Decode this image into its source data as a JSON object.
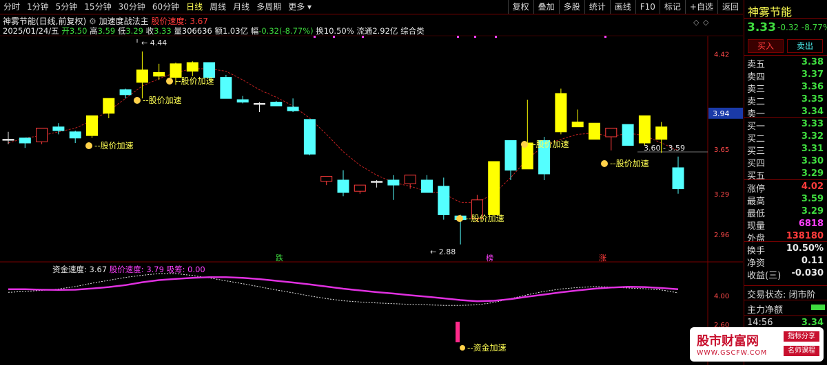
{
  "toolbar": {
    "periods": [
      "分时",
      "1分钟",
      "5分钟",
      "15分钟",
      "30分钟",
      "60分钟",
      "日线",
      "周线",
      "月线",
      "多周期",
      "更多"
    ],
    "active": "日线",
    "right": [
      "复权",
      "叠加",
      "多股",
      "统计",
      "画线",
      "F10",
      "标记",
      "+自选",
      "返回"
    ]
  },
  "info": {
    "title": "神雾节能(日线,前复权)",
    "indicator": "加速度战法主",
    "speed_label": "股价速度:",
    "speed_value": "3.67",
    "date": "2025/01/24/五",
    "open_label": "开",
    "open": "3.50",
    "high_label": "高",
    "high": "3.59",
    "low_label": "低",
    "low": "3.29",
    "close_label": "收",
    "close": "3.33",
    "vol_label": "量",
    "vol": "306636",
    "amt_label": "额",
    "amt": "1.03亿",
    "chg_label": "幅",
    "chg": "-0.32(-8.77%)",
    "turn_label": "换",
    "turn": "10.50%",
    "float_label": "流通",
    "float": "2.92亿",
    "category": "综合类"
  },
  "sub_info": {
    "fund_label": "资金速度:",
    "fund_value": "3.67",
    "stock_label": "股价速度:",
    "stock_value": "3.79",
    "absorb_label": "吸筹:",
    "absorb_value": "0.00"
  },
  "annotations": {
    "accel": "股价加速",
    "fund_accel": "资金加速",
    "high_mark": "4.44",
    "low_mark": "2.88",
    "range_mark": "3.60 - 3.59",
    "tag_fall": "跌",
    "tag_list": "榜",
    "tag_rise": "涨"
  },
  "axis": {
    "main": [
      "4.42",
      "3.94",
      "3.65",
      "3.29",
      "2.96"
    ],
    "sub": [
      "4.00",
      "2.60"
    ],
    "current_price": "3.94"
  },
  "panel": {
    "name": "神雾节能",
    "price": "3.33",
    "change": "-0.32",
    "pct": "-8.77%",
    "buy_btn": "买入",
    "sell_btn": "卖出",
    "asks": [
      {
        "label": "卖五",
        "price": "3.38"
      },
      {
        "label": "卖四",
        "price": "3.37"
      },
      {
        "label": "卖三",
        "price": "3.36"
      },
      {
        "label": "卖二",
        "price": "3.35"
      },
      {
        "label": "卖一",
        "price": "3.34"
      }
    ],
    "bids": [
      {
        "label": "买一",
        "price": "3.33"
      },
      {
        "label": "买二",
        "price": "3.32"
      },
      {
        "label": "买三",
        "price": "3.31"
      },
      {
        "label": "买四",
        "price": "3.30"
      },
      {
        "label": "买五",
        "price": "3.29"
      }
    ],
    "stats": [
      {
        "label": "涨停",
        "value": "4.02",
        "color": "#ff3b3b"
      },
      {
        "label": "最高",
        "value": "3.59",
        "color": "#3fdc3f"
      },
      {
        "label": "最低",
        "value": "3.29",
        "color": "#3fdc3f"
      },
      {
        "label": "现量",
        "value": "6818",
        "color": "#ff40ff"
      },
      {
        "label": "外盘",
        "value": "138180",
        "color": "#ff3b3b"
      }
    ],
    "stats2": [
      {
        "label": "换手",
        "value": "10.50%",
        "color": "#e8e8e8"
      },
      {
        "label": "净资",
        "value": "0.11",
        "color": "#e8e8e8"
      },
      {
        "label": "收益(三)",
        "value": "-0.030",
        "color": "#e8e8e8"
      }
    ],
    "trade_state": "交易状态: 闭市阶",
    "main_net": "主力净额",
    "time": "14:56",
    "time_price": "3.34"
  },
  "watermark": {
    "name": "股市财富网",
    "url": "WWW.GSCFW.COM",
    "tag1": "指标分享",
    "tag2": "名师课程"
  },
  "chart_data": {
    "type": "candlestick",
    "ylim": [
      2.8,
      4.55
    ],
    "candles": [
      {
        "o": 3.73,
        "h": 3.79,
        "l": 3.69,
        "c": 3.73
      },
      {
        "o": 3.7,
        "h": 3.74,
        "l": 3.66,
        "c": 3.74
      },
      {
        "o": 3.71,
        "h": 3.82,
        "l": 3.69,
        "c": 3.82
      },
      {
        "o": 3.8,
        "h": 3.86,
        "l": 3.77,
        "c": 3.83
      },
      {
        "o": 3.74,
        "h": 3.8,
        "l": 3.7,
        "c": 3.79
      },
      {
        "o": 3.76,
        "h": 3.92,
        "l": 3.74,
        "c": 3.92
      },
      {
        "o": 3.94,
        "h": 4.06,
        "l": 3.9,
        "c": 4.06
      },
      {
        "o": 4.09,
        "h": 4.14,
        "l": 4.06,
        "c": 4.13
      },
      {
        "o": 4.19,
        "h": 4.44,
        "l": 4.06,
        "c": 4.29
      },
      {
        "o": 4.27,
        "h": 4.34,
        "l": 4.21,
        "c": 4.24
      },
      {
        "o": 4.23,
        "h": 4.35,
        "l": 4.17,
        "c": 4.34
      },
      {
        "o": 4.28,
        "h": 4.36,
        "l": 4.24,
        "c": 4.35
      },
      {
        "o": 4.35,
        "h": 4.35,
        "l": 4.21,
        "c": 4.23
      },
      {
        "o": 4.23,
        "h": 4.25,
        "l": 4.06,
        "c": 4.06
      },
      {
        "o": 4.05,
        "h": 4.08,
        "l": 4.02,
        "c": 4.03
      },
      {
        "o": 4.02,
        "h": 4.03,
        "l": 3.95,
        "c": 4.02
      },
      {
        "o": 4.03,
        "h": 4.04,
        "l": 4.0,
        "c": 4.0
      },
      {
        "o": 3.99,
        "h": 4.06,
        "l": 3.95,
        "c": 3.96
      },
      {
        "o": 3.89,
        "h": 3.89,
        "l": 3.6,
        "c": 3.61
      },
      {
        "o": 3.39,
        "h": 3.43,
        "l": 3.36,
        "c": 3.43
      },
      {
        "o": 3.4,
        "h": 3.48,
        "l": 3.27,
        "c": 3.3
      },
      {
        "o": 3.31,
        "h": 3.36,
        "l": 3.29,
        "c": 3.36
      },
      {
        "o": 3.39,
        "h": 3.4,
        "l": 3.34,
        "c": 3.39
      },
      {
        "o": 3.4,
        "h": 3.44,
        "l": 3.24,
        "c": 3.36
      },
      {
        "o": 3.37,
        "h": 3.44,
        "l": 3.33,
        "c": 3.44
      },
      {
        "o": 3.4,
        "h": 3.44,
        "l": 3.3,
        "c": 3.3
      },
      {
        "o": 3.35,
        "h": 3.42,
        "l": 3.08,
        "c": 3.12
      },
      {
        "o": 3.11,
        "h": 3.12,
        "l": 2.88,
        "c": 3.08
      },
      {
        "o": 3.09,
        "h": 3.28,
        "l": 3.06,
        "c": 3.24
      },
      {
        "o": 3.12,
        "h": 3.55,
        "l": 3.12,
        "c": 3.55
      },
      {
        "o": 3.48,
        "h": 3.72,
        "l": 3.4,
        "c": 3.72
      },
      {
        "o": 3.7,
        "h": 4.05,
        "l": 3.49,
        "c": 3.49
      },
      {
        "o": 3.45,
        "h": 3.75,
        "l": 3.4,
        "c": 3.72
      },
      {
        "o": 3.79,
        "h": 4.14,
        "l": 3.77,
        "c": 4.1
      },
      {
        "o": 3.83,
        "h": 3.97,
        "l": 3.83,
        "c": 3.87
      },
      {
        "o": 3.86,
        "h": 3.85,
        "l": 3.73,
        "c": 3.73
      },
      {
        "o": 3.75,
        "h": 3.81,
        "l": 3.64,
        "c": 3.82
      },
      {
        "o": 3.68,
        "h": 3.81,
        "l": 3.68,
        "c": 3.85
      },
      {
        "o": 3.7,
        "h": 3.84,
        "l": 3.68,
        "c": 3.92
      },
      {
        "o": 3.83,
        "h": 3.87,
        "l": 3.62,
        "c": 3.73
      },
      {
        "o": 3.5,
        "h": 3.59,
        "l": 3.29,
        "c": 3.33
      }
    ],
    "candle_colors": [
      "w",
      "c",
      "r",
      "c",
      "c",
      "y",
      "y",
      "c",
      "y",
      "y",
      "y",
      "y",
      "c",
      "c",
      "c",
      "w",
      "c",
      "c",
      "c",
      "r",
      "c",
      "r",
      "w",
      "c",
      "r",
      "c",
      "c",
      "c",
      "r",
      "y",
      "c",
      "y",
      "c",
      "y",
      "y",
      "y",
      "r",
      "c",
      "y",
      "y",
      "c"
    ],
    "ma": [
      3.7,
      3.74,
      3.76,
      3.79,
      3.82,
      3.88,
      3.96,
      4.06,
      4.16,
      4.22,
      4.27,
      4.3,
      4.3,
      4.28,
      4.21,
      4.13,
      4.07,
      4.0,
      3.9,
      3.77,
      3.63,
      3.52,
      3.44,
      3.38,
      3.35,
      3.31,
      3.29,
      3.22,
      3.22,
      3.29,
      3.42,
      3.57,
      3.68,
      3.73,
      3.77,
      3.78,
      3.75,
      3.78,
      3.76,
      3.7,
      3.64
    ],
    "fund_speed": [
      0.55,
      0.55,
      0.53,
      0.52,
      0.53,
      0.58,
      0.64,
      0.72,
      0.84,
      0.93,
      0.98,
      1.02,
      1.05,
      1.05,
      1.02,
      0.97,
      0.9,
      0.83,
      0.75,
      0.66,
      0.57,
      0.5,
      0.43,
      0.37,
      0.3,
      0.24,
      0.17,
      0.1,
      0.05,
      0.07,
      0.14,
      0.24,
      0.33,
      0.42,
      0.5,
      0.57,
      0.62,
      0.65,
      0.64,
      0.6,
      0.55
    ],
    "stock_speed": [
      0.42,
      0.46,
      0.5,
      0.56,
      0.66,
      0.8,
      0.92,
      1.04,
      1.13,
      1.2,
      1.2,
      1.12,
      1.02,
      0.9,
      0.78,
      0.65,
      0.52,
      0.4,
      0.27,
      0.16,
      0.07,
      0.02,
      -0.02,
      -0.05,
      -0.08,
      -0.1,
      -0.12,
      -0.12,
      -0.1,
      0.0,
      0.16,
      0.32,
      0.46,
      0.56,
      0.62,
      0.66,
      0.64,
      0.6,
      0.57,
      0.52,
      0.4
    ]
  }
}
